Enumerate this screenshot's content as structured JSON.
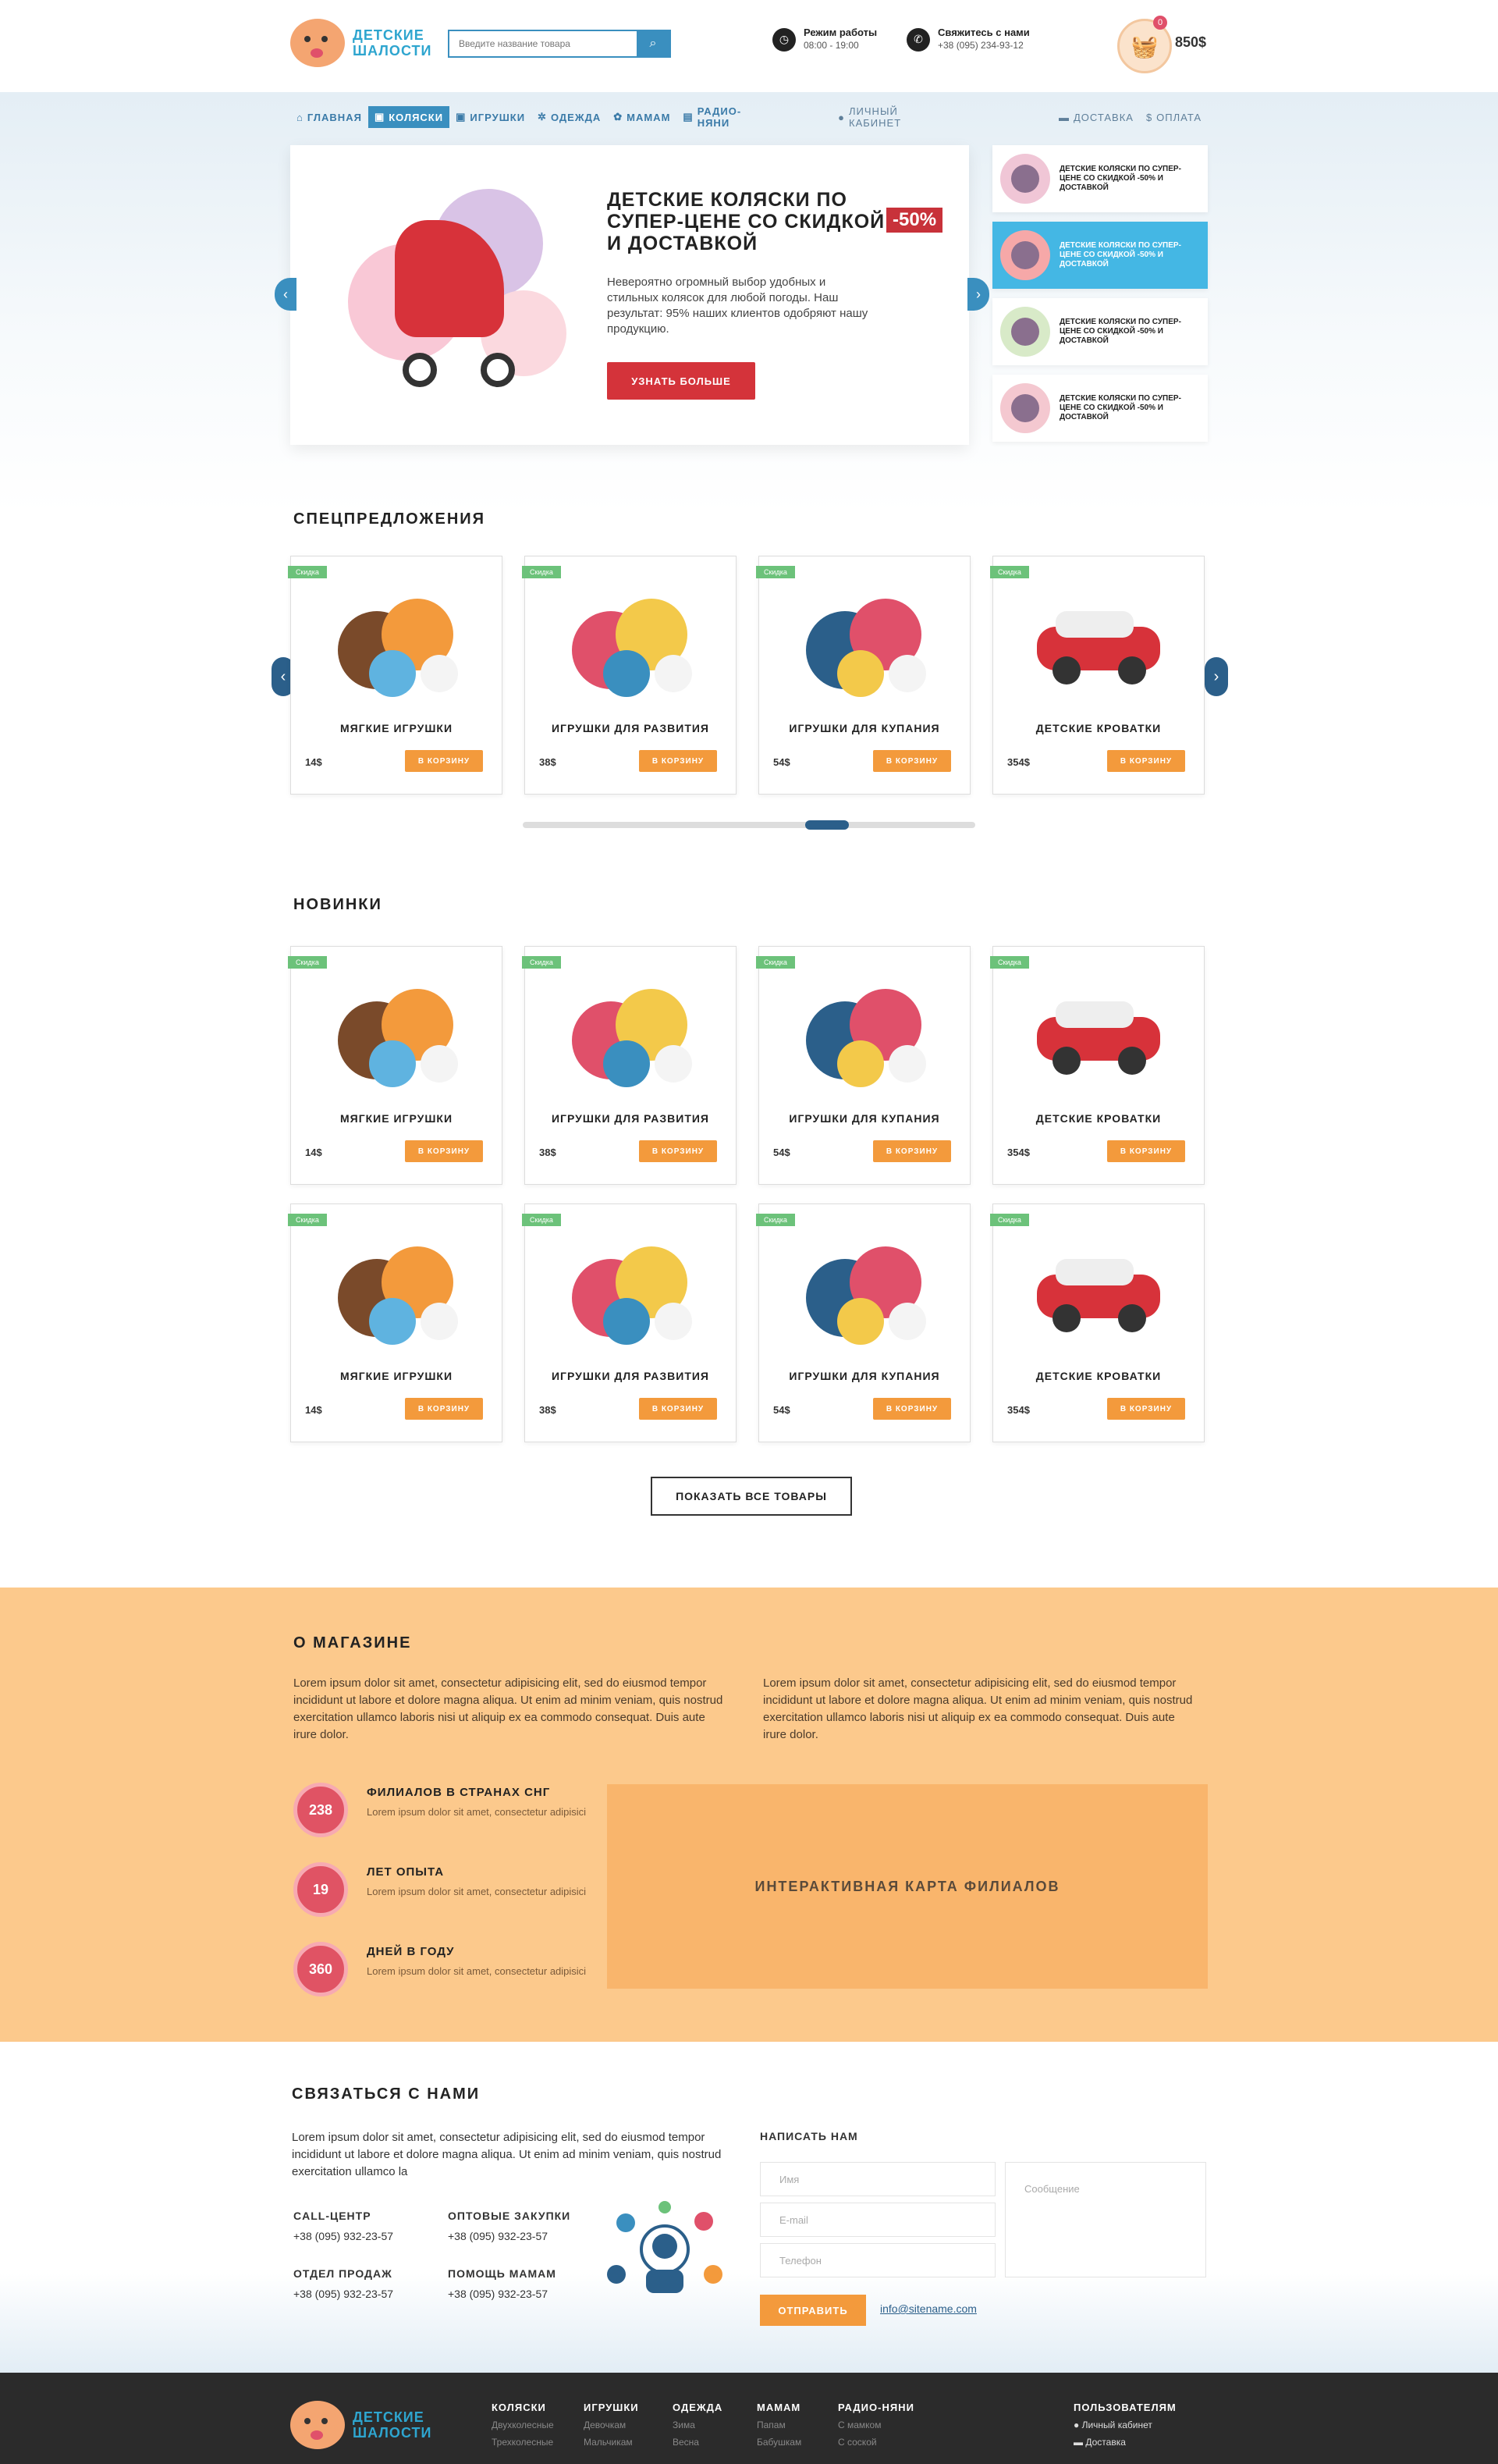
{
  "header": {
    "logo_line1": "ДЕТСКИЕ",
    "logo_line2": "ШАЛОСТИ",
    "search_placeholder": "Введите название товара",
    "hours_title": "Режим работы",
    "hours_value": "08:00 - 19:00",
    "contact_title": "Свяжитесь с нами",
    "contact_value": "+38 (095) 234-93-12",
    "cart_count": "0",
    "cart_sum": "850$"
  },
  "nav": {
    "items": [
      "ГЛАВНАЯ",
      "КОЛЯСКИ",
      "ИГРУШКИ",
      "ОДЕЖДА",
      "МАМАМ",
      "РАДИО-НЯНИ"
    ],
    "account": "ЛИЧНЫЙ КАБИНЕТ",
    "delivery": "ДОСТАВКА",
    "payment": "ОПЛАТА"
  },
  "hero": {
    "title": "ДЕТСКИЕ КОЛЯСКИ ПО СУПЕР-ЦЕНЕ СО СКИДКОЙ И ДОСТАВКОЙ",
    "sale": "-50%",
    "desc": "Невероятно огромный выбор удобных и стильных колясок для любой погоды. Наш результат: 95% наших клиентов одобряют нашу продукцию.",
    "button": "УЗНАТЬ БОЛЬШЕ",
    "thumbs": [
      "ДЕТСКИЕ КОЛЯСКИ ПО СУПЕР-ЦЕНЕ СО СКИДКОЙ -50% И ДОСТАВКОЙ",
      "ДЕТСКИЕ КОЛЯСКИ ПО СУПЕР-ЦЕНЕ СО СКИДКОЙ -50% И ДОСТАВКОЙ",
      "ДЕТСКИЕ КОЛЯСКИ ПО СУПЕР-ЦЕНЕ СО СКИДКОЙ -50% И ДОСТАВКОЙ",
      "ДЕТСКИЕ КОЛЯСКИ ПО СУПЕР-ЦЕНЕ СО СКИДКОЙ -50% И ДОСТАВКОЙ"
    ]
  },
  "specials": {
    "title": "СПЕЦПРЕДЛОЖЕНИЯ",
    "badge": "Скидка",
    "buy": "В КОРЗИНУ",
    "products": [
      {
        "name": "МЯГКИЕ ИГРУШКИ",
        "price": "14$"
      },
      {
        "name": "ИГРУШКИ ДЛЯ РАЗВИТИЯ",
        "price": "38$"
      },
      {
        "name": "ИГРУШКИ ДЛЯ КУПАНИЯ",
        "price": "54$"
      },
      {
        "name": "ДЕТСКИЕ КРОВАТКИ",
        "price": "354$"
      }
    ]
  },
  "new": {
    "title": "НОВИНКИ",
    "show_all": "ПОКАЗАТЬ ВСЕ ТОВАРЫ"
  },
  "about": {
    "title": "О МАГАЗИНЕ",
    "text1": "Lorem ipsum dolor sit amet, consectetur adipisicing elit, sed do eiusmod tempor incididunt ut labore et dolore magna aliqua. Ut enim ad minim veniam, quis nostrud exercitation ullamco laboris nisi ut aliquip ex ea commodo consequat. Duis aute irure dolor.",
    "text2": "Lorem ipsum dolor sit amet, consectetur adipisicing elit, sed do eiusmod tempor incididunt ut labore et dolore magna aliqua. Ut enim ad minim veniam, quis nostrud exercitation ullamco laboris nisi ut aliquip ex ea commodo consequat. Duis aute irure dolor.",
    "stats": [
      {
        "num": "238",
        "title": "ФИЛИАЛОВ В СТРАНАХ СНГ",
        "text": "Lorem ipsum dolor sit amet, consectetur adipisici"
      },
      {
        "num": "19",
        "title": "ЛЕТ ОПЫТА",
        "text": "Lorem ipsum dolor sit amet, consectetur adipisici"
      },
      {
        "num": "360",
        "title": "ДНЕЙ В ГОДУ",
        "text": "Lorem ipsum dolor sit amet, consectetur adipisici"
      }
    ],
    "map": "ИНТЕРАКТИВНАЯ КАРТА ФИЛИАЛОВ"
  },
  "contact": {
    "title": "СВЯЗАТЬСЯ С НАМИ",
    "text": "Lorem ipsum dolor sit amet, consectetur adipisicing elit, sed do eiusmod tempor incididunt ut labore et dolore magna aliqua. Ut enim ad minim veniam, quis nostrud exercitation ullamco la",
    "blocks": [
      {
        "title": "CALL-ЦЕНТР",
        "phone": "+38 (095) 932-23-57"
      },
      {
        "title": "ОПТОВЫЕ ЗАКУПКИ",
        "phone": "+38 (095) 932-23-57"
      },
      {
        "title": "ОТДЕЛ ПРОДАЖ",
        "phone": "+38 (095) 932-23-57"
      },
      {
        "title": "ПОМОЩЬ МАМАМ",
        "phone": "+38 (095) 932-23-57"
      }
    ],
    "form_title": "НАПИСАТЬ НАМ",
    "name_ph": "Имя",
    "email_ph": "E-mail",
    "phone_ph": "Телефон",
    "message_ph": "Сообщение",
    "send": "ОТПРАВИТЬ",
    "email": "info@sitename.com"
  },
  "footer": {
    "logo_line1": "ДЕТСКИЕ",
    "logo_line2": "ШАЛОСТИ",
    "cols": [
      {
        "title": "КОЛЯСКИ",
        "items": [
          "Двухколесные",
          "Трехколесные"
        ]
      },
      {
        "title": "ИГРУШКИ",
        "items": [
          "Девочкам",
          "Мальчикам"
        ]
      },
      {
        "title": "ОДЕЖДА",
        "items": [
          "Зима",
          "Весна"
        ]
      },
      {
        "title": "МАМАМ",
        "items": [
          "Папам",
          "Бабушкам"
        ]
      },
      {
        "title": "РАДИО-НЯНИ",
        "items": [
          "С мамком",
          "С соской"
        ]
      }
    ],
    "users_title": "ПОЛЬЗОВАТЕЛЯМ",
    "users": [
      "Личный кабинет",
      "Доставка"
    ]
  }
}
